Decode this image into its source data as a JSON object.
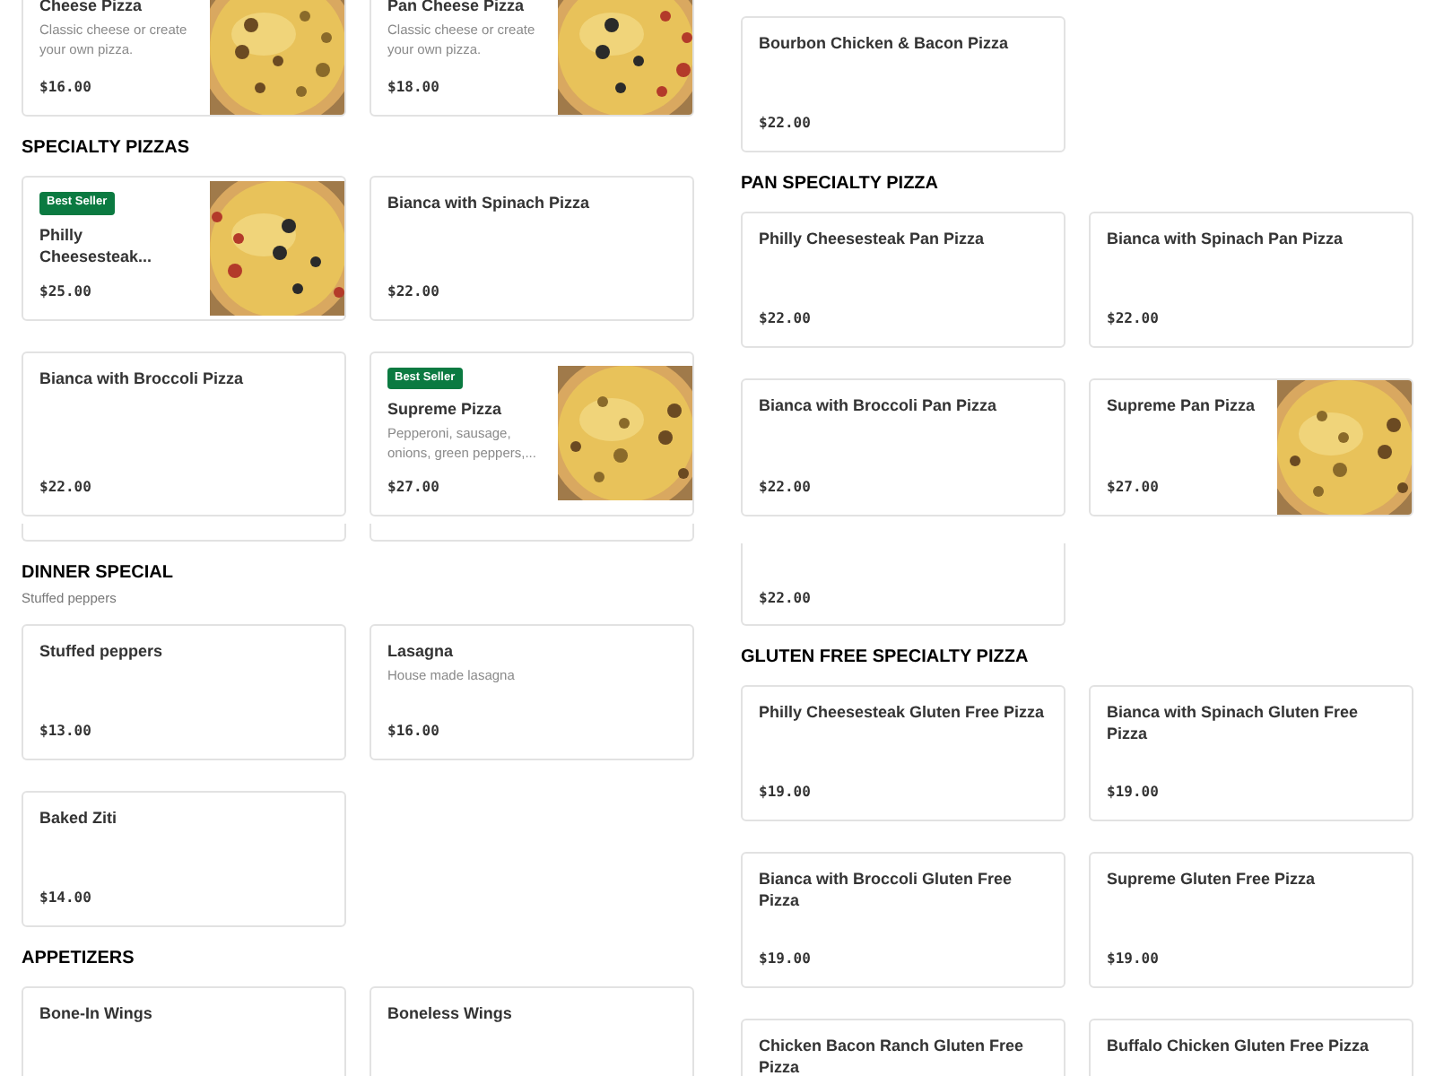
{
  "columns": [
    {
      "sections": [
        {
          "items": [
            {
              "kind": "card",
              "name": "Cheese Pizza",
              "description": "Classic cheese or create your own pizza.",
              "price": "$16.00"
            },
            {
              "kind": "card",
              "name": "Pan Cheese Pizza",
              "description": "Classic cheese or create your own pizza.",
              "price": "$18.00"
            }
          ]
        },
        {
          "title": "SPECIALTY PIZZAS",
          "items": [
            {
              "kind": "card",
              "badge": "Best Seller",
              "name": "Philly Cheesesteak...",
              "price": "$25.00"
            },
            {
              "kind": "card",
              "name": "Bianca with Spinach Pizza",
              "price": "$22.00"
            },
            {
              "kind": "card",
              "name": "Bianca with Broccoli Pizza",
              "price": "$22.00"
            },
            {
              "kind": "card",
              "badge": "Best Seller",
              "name": "Supreme Pizza",
              "description": "Pepperoni, sausage, onions, green peppers,...",
              "price": "$27.00"
            }
          ],
          "cut_off_cards": [
            {
              "kind": "stub"
            },
            {
              "kind": "stub"
            }
          ]
        },
        {
          "title": "DINNER SPECIAL",
          "subtitle": "Stuffed peppers",
          "items": [
            {
              "kind": "card",
              "name": "Stuffed peppers",
              "price": "$13.00"
            },
            {
              "kind": "card",
              "name": "Lasagna",
              "description": "House made lasagna",
              "price": "$16.00"
            },
            {
              "kind": "card",
              "name": "Baked Ziti",
              "price": "$14.00"
            }
          ]
        },
        {
          "title": "APPETIZERS",
          "items": [
            {
              "kind": "card",
              "name": "Bone-In Wings"
            },
            {
              "kind": "card",
              "name": "Boneless Wings"
            }
          ]
        }
      ]
    },
    {
      "sections": [
        {
          "items": [
            {
              "kind": "card",
              "name": "Bourbon Chicken & Bacon Pizza",
              "price": "$22.00"
            }
          ]
        },
        {
          "title": "PAN SPECIALTY PIZZA",
          "items": [
            {
              "kind": "card",
              "name": "Philly Cheesesteak Pan Pizza",
              "price": "$22.00"
            },
            {
              "kind": "card",
              "name": "Bianca with Spinach Pan Pizza",
              "price": "$22.00"
            },
            {
              "kind": "card",
              "name": "Bianca with Broccoli Pan Pizza",
              "price": "$22.00"
            },
            {
              "kind": "card",
              "name": "Supreme Pan Pizza",
              "price": "$27.00"
            }
          ],
          "cut_off_cards": [
            {
              "kind": "stub",
              "price": "$22.00"
            }
          ]
        },
        {
          "title": "GLUTEN FREE SPECIALTY PIZZA",
          "items": [
            {
              "kind": "card",
              "name": "Philly Cheesesteak Gluten Free Pizza",
              "price": "$19.00"
            },
            {
              "kind": "card",
              "name": "Bianca with Spinach Gluten Free Pizza",
              "price": "$19.00"
            },
            {
              "kind": "card",
              "name": "Bianca with Broccoli Gluten Free Pizza",
              "price": "$19.00"
            },
            {
              "kind": "card",
              "name": "Supreme Gluten Free Pizza",
              "price": "$19.00"
            },
            {
              "kind": "card",
              "name": "Chicken Bacon Ranch Gluten Free Pizza"
            },
            {
              "kind": "card",
              "name": "Buffalo Chicken Gluten Free Pizza"
            }
          ]
        }
      ]
    }
  ]
}
